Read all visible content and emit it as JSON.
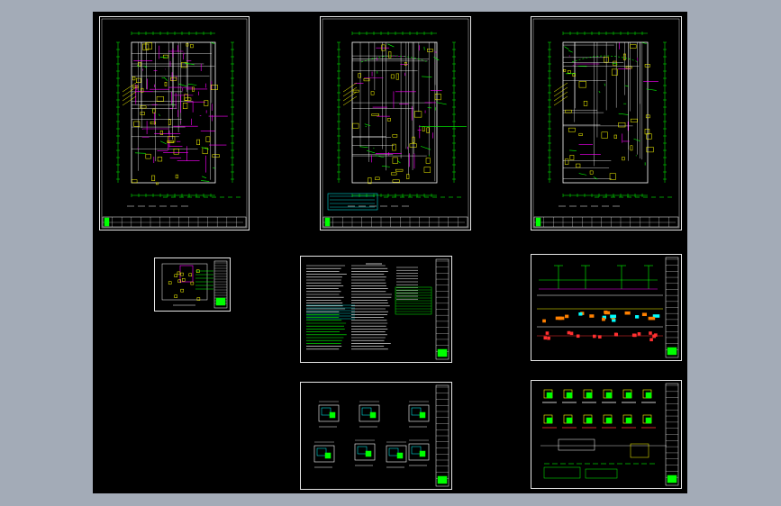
{
  "app": {
    "background_color": "#a3abb7",
    "canvas_color": "#000000"
  },
  "colors": {
    "sheet_border": "#e6e6e6",
    "magenta": "#ff00ff",
    "green": "#00ff00",
    "yellow": "#ffff00",
    "red": "#ff3030",
    "cyan": "#00ffff",
    "white": "#ffffff",
    "orange": "#ff8000"
  },
  "sheets": [
    {
      "id": "floor-plan-1",
      "kind": "plan",
      "variant": "dense"
    },
    {
      "id": "floor-plan-2",
      "kind": "plan",
      "variant": "mid"
    },
    {
      "id": "floor-plan-3",
      "kind": "plan",
      "variant": "light"
    },
    {
      "id": "small-plan",
      "kind": "small"
    },
    {
      "id": "design-notes",
      "kind": "notes"
    },
    {
      "id": "riser-diagram",
      "kind": "riser"
    },
    {
      "id": "detail-plans",
      "kind": "details"
    },
    {
      "id": "equipment-details",
      "kind": "equip"
    }
  ]
}
